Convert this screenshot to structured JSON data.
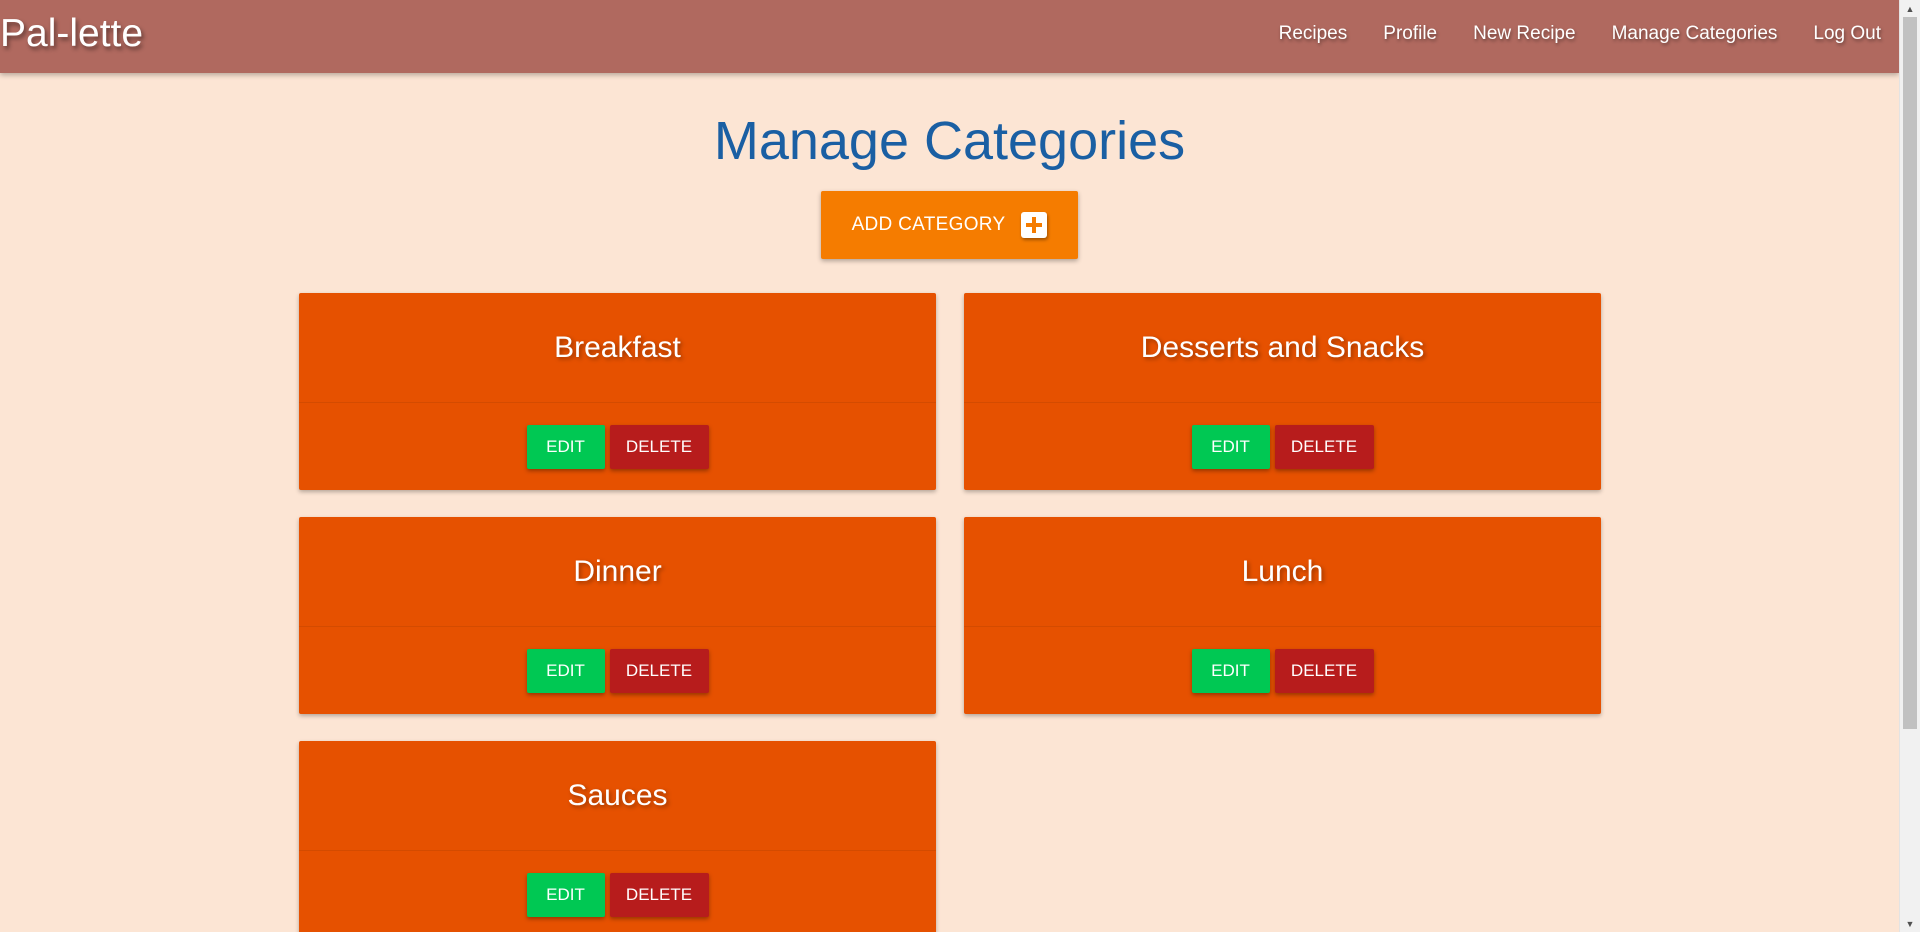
{
  "navbar": {
    "brand": "Pal-lette",
    "links": [
      "Recipes",
      "Profile",
      "New Recipe",
      "Manage Categories",
      "Log Out"
    ]
  },
  "page": {
    "title": "Manage Categories",
    "add_button_label": "ADD CATEGORY"
  },
  "categories": [
    {
      "name": "Breakfast",
      "edit_label": "EDIT",
      "delete_label": "DELETE"
    },
    {
      "name": "Desserts and Snacks",
      "edit_label": "EDIT",
      "delete_label": "DELETE"
    },
    {
      "name": "Dinner",
      "edit_label": "EDIT",
      "delete_label": "DELETE"
    },
    {
      "name": "Lunch",
      "edit_label": "EDIT",
      "delete_label": "DELETE"
    },
    {
      "name": "Sauces",
      "edit_label": "EDIT",
      "delete_label": "DELETE"
    }
  ],
  "colors": {
    "navbar": "#b0695f",
    "background": "#fce5d4",
    "title": "#1a5fa3",
    "add_button": "#f57c00",
    "card": "#e65100",
    "edit_button": "#00c853",
    "delete_button": "#b71c1c"
  },
  "icons": {
    "add_button": "plus-icon"
  }
}
